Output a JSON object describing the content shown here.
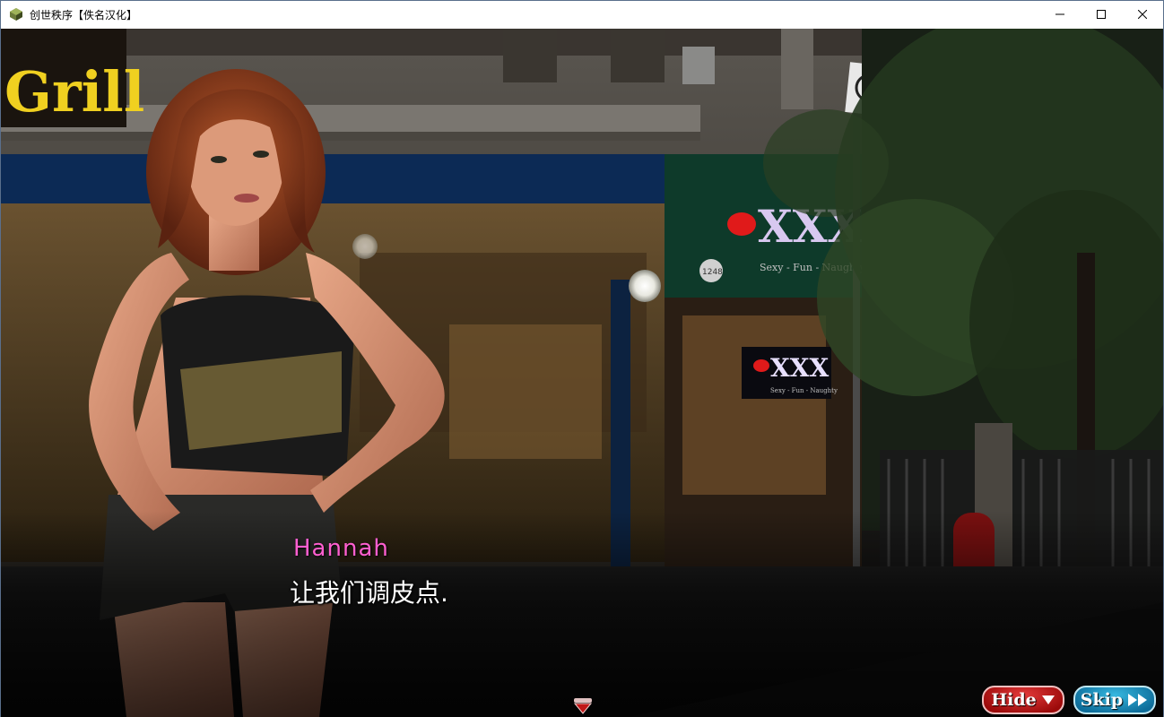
{
  "window": {
    "title": "创世秩序【佚名汉化】"
  },
  "signs": {
    "grill": "Grill",
    "address": "1248",
    "address_small": "1248",
    "xxx_big": "XXX",
    "xxx_tagline": "Sexy - Fun - Naughty",
    "xxx_small": "XXX",
    "xxx_small_tagline": "Sexy - Fun - Naughty"
  },
  "dialogue": {
    "speaker": "Hannah",
    "text": "让我们调皮点."
  },
  "buttons": {
    "hide_label": "Hide",
    "skip_label": "Skip"
  },
  "colors": {
    "speaker": "#ff5fd0",
    "hide_button": "#c01818",
    "skip_button": "#1a90c0"
  }
}
